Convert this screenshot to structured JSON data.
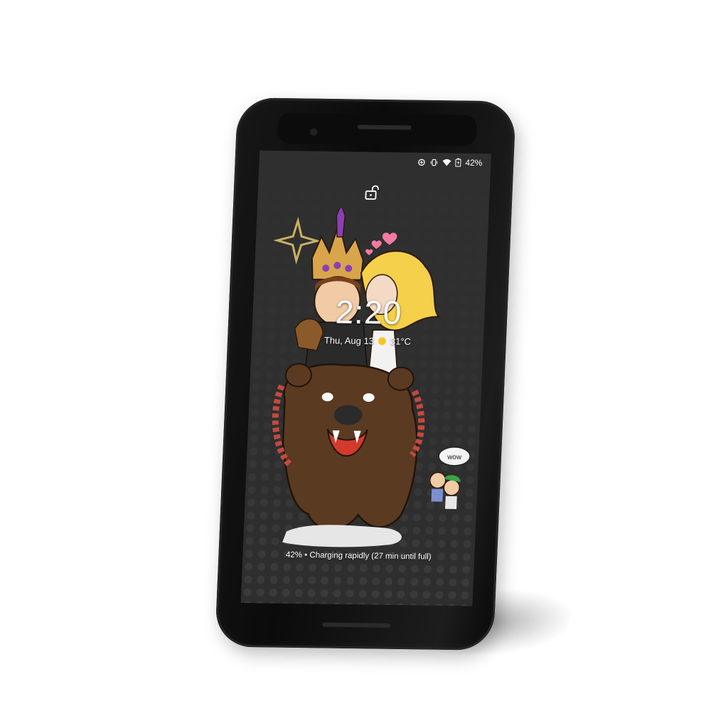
{
  "device": {
    "type": "phone",
    "frame_color": "#111111"
  },
  "status_bar": {
    "icons": [
      "data-saver-icon",
      "vibrate-icon",
      "wifi-icon",
      "battery-charging-icon"
    ],
    "battery_percent": "42%"
  },
  "lock_screen": {
    "lock_icon": "unlock-icon",
    "time": "2:20",
    "date": "Thu, Aug 13",
    "weather_icon": "sun-icon",
    "temperature": "31°C",
    "charging_status": "42% • Charging rapidly (27 min until full)"
  },
  "wallpaper": {
    "description_icon": "illustration-bear-riders",
    "speech_bubble_text": "wow",
    "colors": {
      "background": "#2d2d2d",
      "dots": "#3e3e3e",
      "bear": "#5b3a22",
      "crown": "#d9a54a",
      "gems": "#8a3fb5",
      "hair": "#f5d04a",
      "hearts": "#f37aa0"
    }
  }
}
